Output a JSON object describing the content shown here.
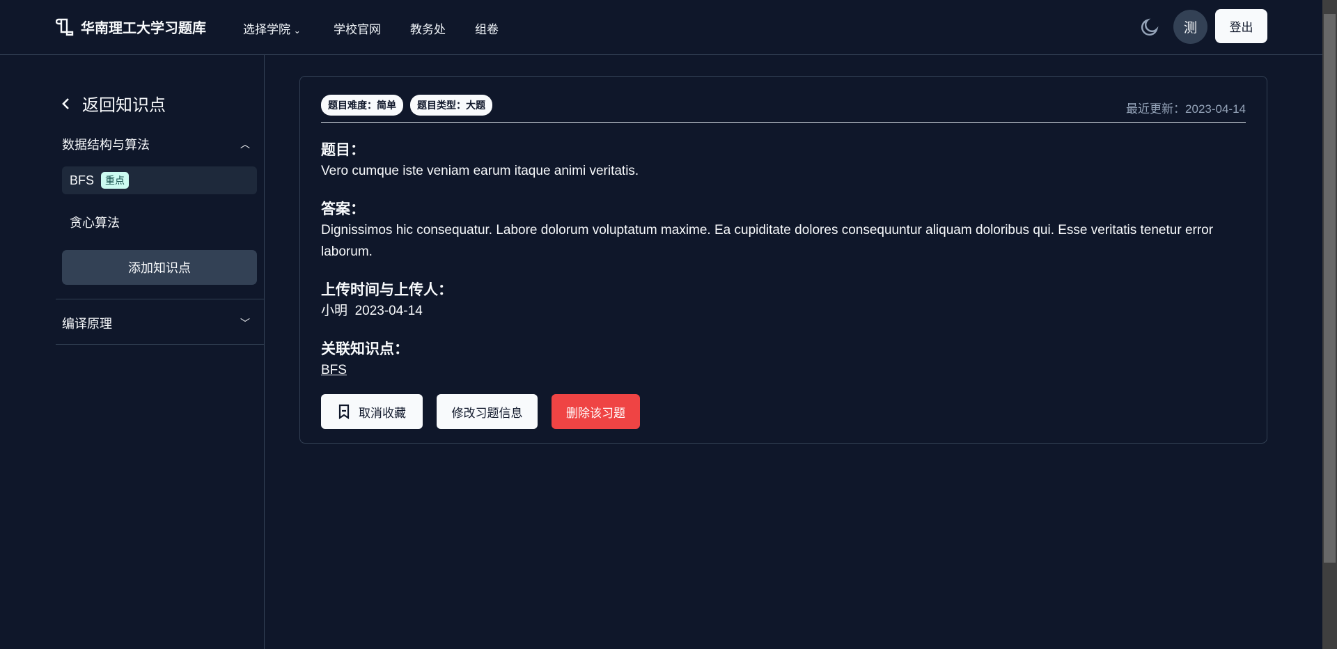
{
  "header": {
    "title": "华南理工大学习题库",
    "nav": [
      "选择学院",
      "学校官网",
      "教务处",
      "组卷"
    ],
    "avatar": "测",
    "logout": "登出"
  },
  "sidebar": {
    "back": "返回知识点",
    "sections": [
      {
        "title": "数据结构与算法",
        "expanded": true,
        "items": [
          {
            "label": "BFS",
            "badge": "重点"
          },
          {
            "label": "贪心算法"
          }
        ],
        "add": "添加知识点"
      },
      {
        "title": "编译原理",
        "expanded": false
      }
    ]
  },
  "card": {
    "tags": [
      "题目难度：简单",
      "题目类型：大题"
    ],
    "updated": "最近更新：2023-04-14",
    "question_label": "题目：",
    "question": "Vero cumque iste veniam earum itaque animi veritatis.",
    "answer_label": "答案：",
    "answer": "Dignissimos hic consequatur. Labore dolorum voluptatum maxime. Ea cupiditate dolores consequuntur aliquam doloribus qui. Esse veritatis tenetur error laborum.",
    "upload_label": "上传时间与上传人：",
    "uploader": "小明",
    "upload_date": "2023-04-14",
    "kp_label": "关联知识点：",
    "kp": "BFS",
    "buttons": {
      "unfav": "取消收藏",
      "edit": "修改习题信息",
      "delete": "删除该习题"
    }
  },
  "colors": {
    "bg": "#0f172a",
    "danger": "#ef4444",
    "badge": "#ccfbf1"
  }
}
